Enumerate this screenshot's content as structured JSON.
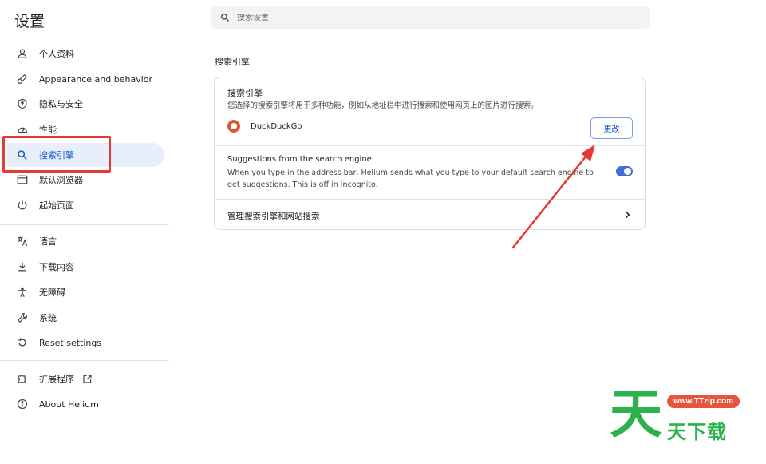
{
  "sidebar": {
    "title": "设置",
    "items": [
      {
        "label": "个人资料",
        "icon": "person-icon"
      },
      {
        "label": "Appearance and behavior",
        "icon": "paintbrush-icon"
      },
      {
        "label": "隐私与安全",
        "icon": "shield-icon"
      },
      {
        "label": "性能",
        "icon": "speedometer-icon"
      },
      {
        "label": "搜索引擎",
        "icon": "search-icon",
        "active": true
      },
      {
        "label": "默认浏览器",
        "icon": "browser-window-icon"
      },
      {
        "label": "起始页面",
        "icon": "power-icon"
      },
      {
        "label": "语言",
        "icon": "translate-icon"
      },
      {
        "label": "下载内容",
        "icon": "download-icon"
      },
      {
        "label": "无障碍",
        "icon": "accessibility-icon"
      },
      {
        "label": "系统",
        "icon": "wrench-icon"
      },
      {
        "label": "Reset settings",
        "icon": "reset-icon"
      },
      {
        "label": "扩展程序",
        "icon": "puzzle-icon"
      },
      {
        "label": "About Helium",
        "icon": "info-icon"
      }
    ]
  },
  "search": {
    "placeholder": "搜索设置"
  },
  "main": {
    "section_title": "搜索引擎",
    "card": {
      "title": "搜索引擎",
      "description": "您选择的搜索引擎将用于多种功能，例如从地址栏中进行搜索和使用网页上的图片进行搜索。",
      "engine_name": "DuckDuckGo",
      "change_label": "更改",
      "suggestions_title": "Suggestions from the search engine",
      "suggestions_desc": "When you type in the address bar, Helium sends what you type to your default search engine to get suggestions. This is off in Incognito.",
      "suggestions_enabled": true,
      "manage_label": "管理搜索引擎和网站搜索"
    }
  },
  "watermark": {
    "big_char": "天",
    "url": "www.TTzip.com",
    "text": "天下载"
  },
  "colors": {
    "accent": "#0b57d0",
    "active_bg": "#e8eefa",
    "annotation_red": "#e53935",
    "toggle_on": "#3f6ad8",
    "watermark_green": "#2bb24c"
  }
}
